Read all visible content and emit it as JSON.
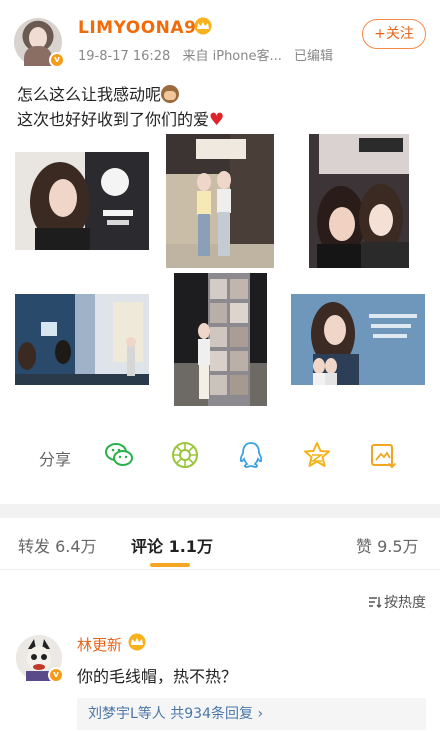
{
  "post": {
    "username": "LIMYOONA90",
    "date": "19-8-17 16:28",
    "source": "来自 iPhone客...",
    "edited": "已编辑",
    "follow_label": "+关注",
    "text_line1": "怎么这么让我感动呢",
    "text_line2": "这次也好好收到了你们的爱",
    "images": [
      "photo-1",
      "photo-2",
      "photo-3",
      "photo-4",
      "photo-5",
      "photo-6"
    ]
  },
  "actions": {
    "share_label": "分享",
    "icons": [
      "wechat-icon",
      "moments-icon",
      "qq-icon",
      "qzone-icon",
      "save-image-icon"
    ]
  },
  "stats": {
    "repost_label": "转发",
    "repost_count": "6.4万",
    "comment_label": "评论",
    "comment_count": "1.1万",
    "like_label": "赞",
    "like_count": "9.5万"
  },
  "sort_label": "按热度",
  "comment": {
    "author": "林更新",
    "text": "你的毛线帽，热不热？",
    "replies_text": "刘梦宇L等人",
    "replies_count": "共934条回复",
    "replies_arrow": "›"
  },
  "colors": {
    "accent_orange": "#f26b09",
    "tab_indicator": "#f5a623",
    "link_blue": "#4a77a8"
  }
}
